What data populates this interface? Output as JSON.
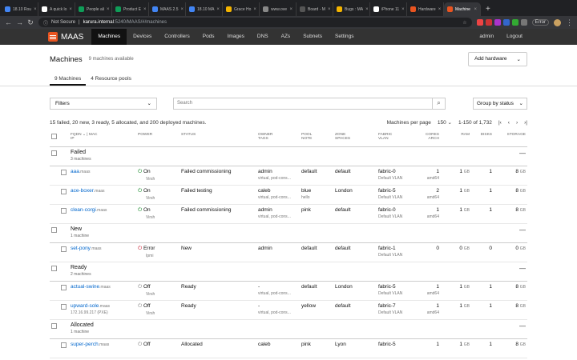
{
  "browser": {
    "tabs": [
      {
        "title": "18.10 Rou",
        "color": "#4285f4"
      },
      {
        "title": "A quick lo",
        "color": "#ffffff"
      },
      {
        "title": "People ali",
        "color": "#0f9d58"
      },
      {
        "title": "Product E",
        "color": "#0f9d58"
      },
      {
        "title": "MAAS 2.5",
        "color": "#4285f4"
      },
      {
        "title": "18.10 MA",
        "color": "#4285f4"
      },
      {
        "title": "Grace Ho",
        "color": "#f4b400"
      },
      {
        "title": "www.ove",
        "color": "#888888"
      },
      {
        "title": "Board - M",
        "color": "#555555"
      },
      {
        "title": "Bugs : MA",
        "color": "#f4b400"
      },
      {
        "title": "iPhone 11",
        "color": "#ffffff"
      },
      {
        "title": "Hardware",
        "color": "#e95420"
      },
      {
        "title": "Machine",
        "color": "#e95420",
        "active": true
      }
    ],
    "address": {
      "security": "Not Secure",
      "host": "karura.internal",
      "path": ":5240/MAAS/#/machines"
    },
    "error_label": "Error"
  },
  "nav": {
    "logo": "MAAS",
    "links": [
      "Machines",
      "Devices",
      "Controllers",
      "Pods",
      "Images",
      "DNS",
      "AZs",
      "Subnets",
      "Settings"
    ],
    "active": "Machines",
    "user": "admin",
    "logout": "Logout"
  },
  "header": {
    "title": "Machines",
    "subtitle": "9 machines available",
    "add_hardware": "Add hardware"
  },
  "subtabs": [
    "9 Machines",
    "4 Resource pools"
  ],
  "toolbar": {
    "filters": "Filters",
    "search_placeholder": "Search",
    "group_by": "Group by status"
  },
  "summary": {
    "text": "15 failed, 20 new, 3 ready, 5 allocated, and 200 deployed machines.",
    "per_page_label": "Machines per page",
    "per_page": "150",
    "range": "1-150 of 1,732"
  },
  "columns": {
    "fqdn": "FQDN",
    "mac": "| MAC",
    "ip": "IP",
    "power": "POWER",
    "status": "STATUS",
    "owner": "OWNER",
    "tags": "TAGS",
    "pool": "POOL",
    "note": "NOTE",
    "zone": "ZONE",
    "spaces": "SPACES",
    "fabric": "FABRIC",
    "vlan": "VLAN",
    "cores": "CORES",
    "arch": "ARCH",
    "ram": "RAM",
    "disks": "DISKS",
    "storage": "STORAGE"
  },
  "groups": [
    {
      "name": "Failed",
      "count": "3 machines",
      "collapse": "—",
      "machines": [
        {
          "host": "aaa",
          "domain": ".maas",
          "ip": "",
          "power": "On",
          "power_type": "Virsh",
          "power_state": "on",
          "status": "Failed commissioning",
          "owner": "admin",
          "tags": "virtual, pod-cons...",
          "pool": "default",
          "note": "",
          "zone": "default",
          "fabric": "fabric-0",
          "vlan": "Default VLAN",
          "cores": "1",
          "arch": "amd64",
          "ram": "1",
          "disks": "1",
          "storage": "8"
        },
        {
          "host": "ace-boxer",
          "domain": ".maas",
          "ip": "",
          "power": "On",
          "power_type": "Virsh",
          "power_state": "on",
          "status": "Failed testing",
          "owner": "caleb",
          "tags": "virtual, pod-cons...",
          "pool": "blue",
          "note": "hello",
          "zone": "London",
          "fabric": "fabric-5",
          "vlan": "Default VLAN",
          "cores": "2",
          "arch": "amd64",
          "ram": "1",
          "disks": "1",
          "storage": "8"
        },
        {
          "host": "clean-corgi",
          "domain": ".maas",
          "ip": "",
          "power": "On",
          "power_type": "Virsh",
          "power_state": "on",
          "status": "Failed commissioning",
          "owner": "admin",
          "tags": "virtual, pod-cons...",
          "pool": "pink",
          "note": "",
          "zone": "default",
          "fabric": "fabric-0",
          "vlan": "Default VLAN",
          "cores": "1",
          "arch": "amd64",
          "ram": "1",
          "disks": "1",
          "storage": "8"
        }
      ]
    },
    {
      "name": "New",
      "count": "1 machine",
      "collapse": "—",
      "machines": [
        {
          "host": "set-pony",
          "domain": ".maas",
          "ip": "",
          "power": "Error",
          "power_type": "Ipmi",
          "power_state": "error",
          "status": "New",
          "owner": "admin",
          "tags": "",
          "pool": "default",
          "note": "",
          "zone": "default",
          "fabric": "fabric-1",
          "vlan": "Default VLAN",
          "cores": "0",
          "arch": "",
          "ram": "0",
          "disks": "0",
          "storage": "0"
        }
      ]
    },
    {
      "name": "Ready",
      "count": "2 machines",
      "collapse": "—",
      "machines": [
        {
          "host": "actual-swine",
          "domain": ".maas",
          "ip": "",
          "power": "Off",
          "power_type": "Virsh",
          "power_state": "off",
          "status": "Ready",
          "owner": "-",
          "tags": "virtual, pod-cons...",
          "pool": "default",
          "note": "",
          "zone": "London",
          "fabric": "fabric-5",
          "vlan": "Default VLAN",
          "cores": "1",
          "arch": "amd64",
          "ram": "1",
          "disks": "1",
          "storage": "8"
        },
        {
          "host": "upward-sole",
          "domain": ".maas",
          "ip": "172.16.99.217 (PXE)",
          "power": "Off",
          "power_type": "Virsh",
          "power_state": "off",
          "status": "Ready",
          "owner": "-",
          "tags": "virtual, pod-cons...",
          "pool": "yellow",
          "note": "",
          "zone": "default",
          "fabric": "fabric-7",
          "vlan": "Default VLAN",
          "cores": "1",
          "arch": "amd64",
          "ram": "1",
          "disks": "1",
          "storage": "8"
        }
      ]
    },
    {
      "name": "Allocated",
      "count": "1 machine",
      "collapse": "—",
      "machines": [
        {
          "host": "super-perch",
          "domain": ".maas",
          "ip": "",
          "power": "Off",
          "power_type": "",
          "power_state": "off",
          "status": "Allocated",
          "owner": "caleb",
          "tags": "",
          "pool": "pink",
          "note": "",
          "zone": "Lyon",
          "fabric": "fabric-5",
          "vlan": "",
          "cores": "1",
          "arch": "",
          "ram": "1",
          "disks": "1",
          "storage": "8"
        }
      ]
    }
  ],
  "units": {
    "ram": "GB",
    "storage": "GB"
  }
}
